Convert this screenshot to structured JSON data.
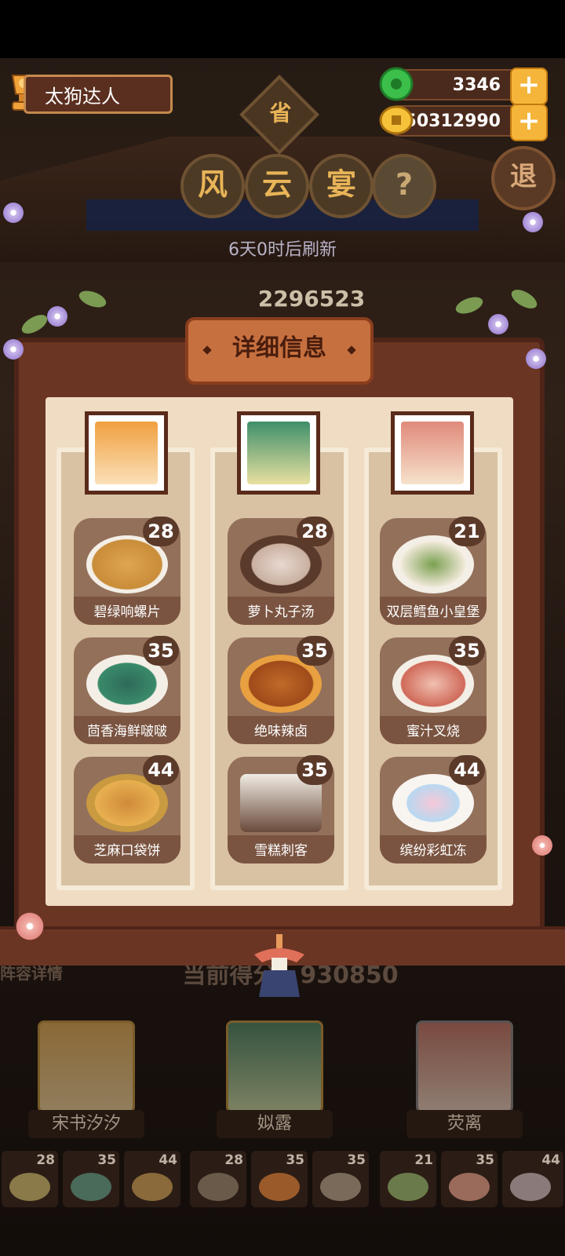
{
  "player": {
    "name": "太狗达人"
  },
  "resources": {
    "jade": "3346",
    "coins": "50312990",
    "plus": "+"
  },
  "event": {
    "province": "省",
    "title_chars": [
      "风",
      "云",
      "宴"
    ],
    "help": "?",
    "back": "退",
    "refresh_text": "6天0时后刷新",
    "score": "2296523"
  },
  "panel": {
    "title": "详细信息",
    "columns": [
      {
        "character": "宋书汐汐",
        "dishes": [
          {
            "name": "碧绿响螺片",
            "level": "28"
          },
          {
            "name": "茴香海鲜啵啵",
            "level": "35"
          },
          {
            "name": "芝麻口袋饼",
            "level": "44"
          }
        ]
      },
      {
        "character": "姒露",
        "dishes": [
          {
            "name": "萝卜丸子汤",
            "level": "28"
          },
          {
            "name": "绝味辣卤",
            "level": "35"
          },
          {
            "name": "雪糕刺客",
            "level": "35"
          }
        ]
      },
      {
        "character": "荧离",
        "dishes": [
          {
            "name": "双层鳕鱼小皇堡",
            "level": "21"
          },
          {
            "name": "蜜汁叉烧",
            "level": "35"
          },
          {
            "name": "缤纷彩虹冻",
            "level": "44"
          }
        ]
      }
    ]
  },
  "bottom": {
    "lineup_label": "阵容详情",
    "current_score": "当前得分：930850",
    "heroes": [
      "宋书汐汐",
      "姒露",
      "荧离"
    ],
    "slot_levels": [
      "28",
      "35",
      "44",
      "28",
      "35",
      "35",
      "21",
      "35",
      "44"
    ]
  },
  "colors": {
    "panel": "#6b3524",
    "parchment": "#efdcc3",
    "accent": "#e8b457",
    "plus": "#f5b53a"
  }
}
